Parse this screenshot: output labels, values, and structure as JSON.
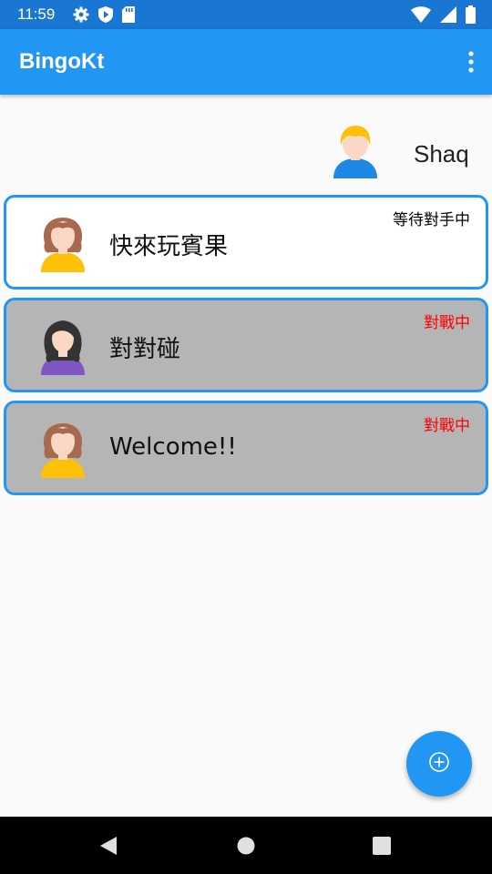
{
  "status_bar": {
    "time": "11:59",
    "icons_left": [
      "gear-icon",
      "shield-play-icon",
      "sd-card-icon"
    ],
    "icons_right": [
      "wifi-icon",
      "signal-icon",
      "battery-icon"
    ]
  },
  "app_bar": {
    "title": "BingoKt",
    "menu_icon": "more-vert-icon",
    "color": "#2196F3"
  },
  "profile": {
    "name": "Shaq",
    "avatar": "boy-yellow-hair-avatar"
  },
  "rooms": [
    {
      "name": "快來玩賓果",
      "status": "等待對手中",
      "status_color": "#000000",
      "background": "#FFFFFF",
      "avatar": "girl-brown-hair-avatar"
    },
    {
      "name": "對對碰",
      "status": "對戰中",
      "status_color": "#FF0000",
      "background": "#B5B5B5",
      "avatar": "girl-black-hair-avatar"
    },
    {
      "name": "Welcome!!",
      "status": "對戰中",
      "status_color": "#FF0000",
      "background": "#B5B5B5",
      "avatar": "girl-brown-hair-avatar"
    }
  ],
  "fab": {
    "icon": "add-circle-icon",
    "color": "#2196F3"
  },
  "nav_bar": {
    "buttons": [
      "back-icon",
      "home-icon",
      "recents-icon"
    ]
  }
}
